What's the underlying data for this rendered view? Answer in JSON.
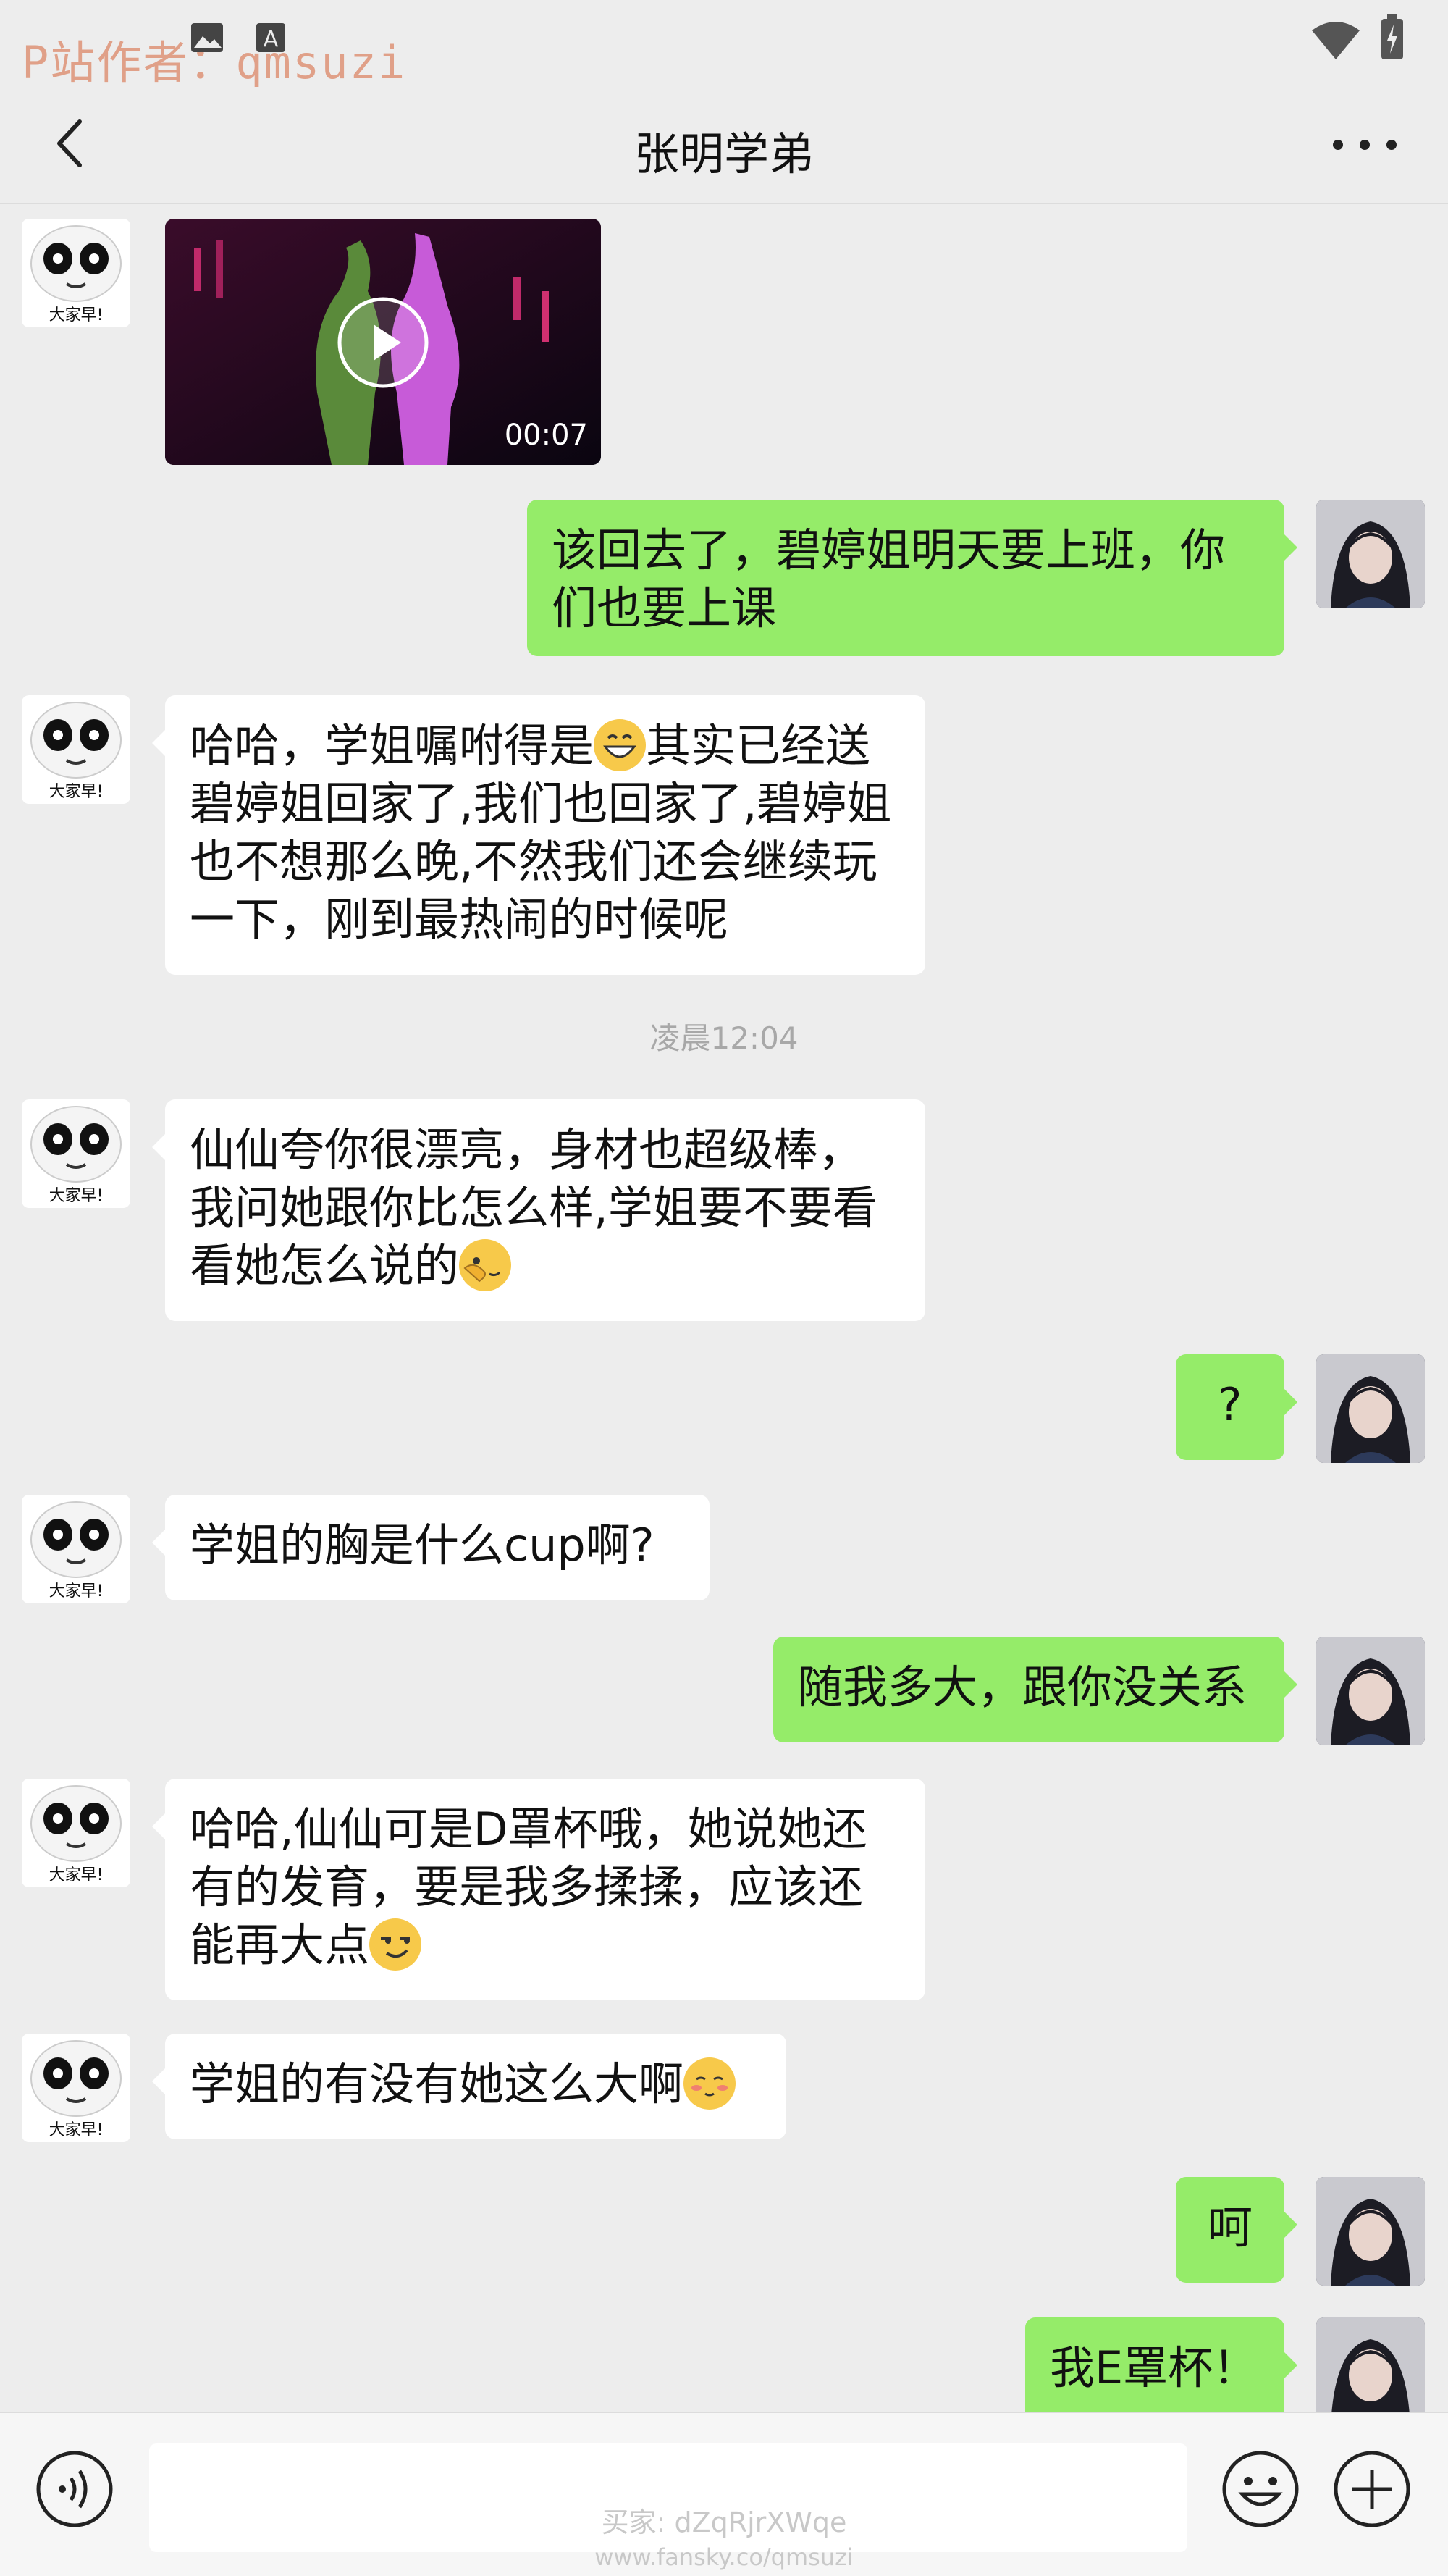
{
  "status_bar": {
    "watermark": "P站作者：qmsuzi"
  },
  "navbar": {
    "title": "张明学弟"
  },
  "video_message": {
    "duration": "00:07"
  },
  "messages": [
    {
      "text": "该回去了，碧婷姐明天要上班，你\n们也要上课"
    },
    {
      "text": "哈哈，学姐嘱咐得是"
    },
    {
      "text": "其实已经送\n碧婷姐回家了,我们也回家了,碧婷姐\n也不想那么晚,不然我们还会继续玩\n一下，刚到最热闹的时候呢"
    },
    {
      "text": "凌晨12:04"
    },
    {
      "text": "仙仙夸你很漂亮，身材也超级棒，\n我问她跟你比怎么样,学姐要不要看\n看她怎么说的"
    },
    {
      "text": "?"
    },
    {
      "text": "学姐的胸是什么cup啊?"
    },
    {
      "text": "随我多大，跟你没关系"
    },
    {
      "text": "哈哈,仙仙可是D罩杯哦，她说她还\n有的发育，要是我多揉揉，应该还\n能再大点"
    },
    {
      "text": "学姐的有没有她这么大啊"
    },
    {
      "text": "呵"
    },
    {
      "text": "我E罩杯！"
    }
  ],
  "input_bar": {
    "watermark_buyer": "买家: dZqRjrXWqe",
    "watermark_url": "www.fansky.co/qmsuzi"
  },
  "icons": [
    "back-icon",
    "more-icon",
    "voice-icon",
    "emoji-icon",
    "plus-icon",
    "play-icon",
    "wifi-icon",
    "battery-icon"
  ],
  "colors": {
    "sent_bubble": "#95ec69",
    "received_bubble": "#ffffff",
    "background": "#ededed"
  }
}
